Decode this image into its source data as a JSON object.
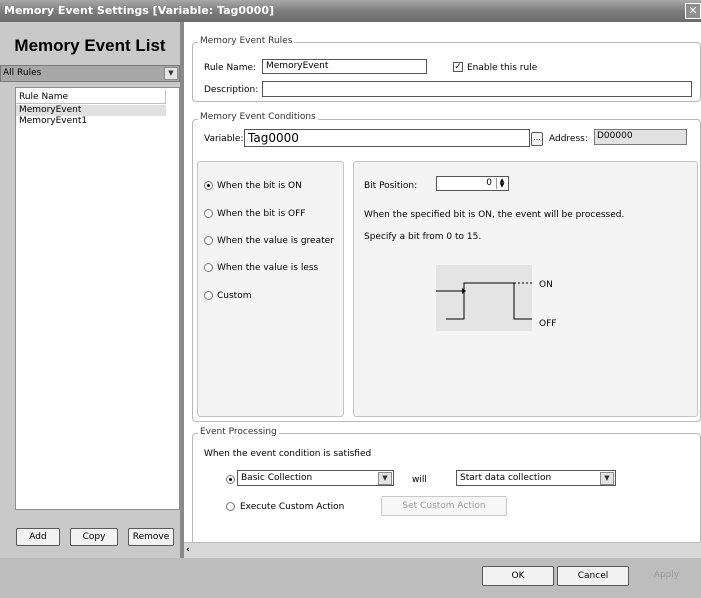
{
  "window": {
    "title": "Memory Event Settings [Variable: Tag0000]",
    "close_glyph": "✕"
  },
  "left": {
    "heading": "Memory Event List",
    "filter_value": "All Rules",
    "column_header": "Rule Name",
    "rules": [
      "MemoryEvent",
      "MemoryEvent1"
    ],
    "buttons": {
      "add": "Add",
      "copy": "Copy",
      "remove": "Remove"
    }
  },
  "rules_group": {
    "label": "Memory Event Rules",
    "rule_name_label": "Rule Name:",
    "rule_name_value": "MemoryEvent",
    "enable_label": "Enable this rule",
    "enable_checked": true,
    "description_label": "Description:",
    "description_value": ""
  },
  "conditions_group": {
    "label": "Memory Event Conditions",
    "variable_label": "Variable:",
    "variable_value": "Tag0000",
    "browse_label": "...",
    "address_label": "Address:",
    "address_value": "D00000",
    "options": [
      "When the bit is ON",
      "When the bit is OFF",
      "When the value is greater",
      "When the value is less",
      "Custom"
    ],
    "selected_index": 0,
    "bit_position_label": "Bit Position:",
    "bit_position_value": "0",
    "info_text": "When the specified bit is ON, the event will be processed.",
    "range_text": "Specify a bit from 0 to 15.",
    "diagram_on_label": "ON",
    "diagram_off_label": "OFF"
  },
  "processing_group": {
    "label": "Event Processing",
    "condition_text": "When the event condition is satisfied",
    "collection_value": "Basic Collection",
    "will_label": "will",
    "action_value": "Start data collection",
    "custom_action_label": "Execute Custom Action",
    "set_custom_action_label": "Set Custom Action"
  },
  "footer": {
    "ok": "OK",
    "cancel": "Cancel",
    "apply": "Apply"
  },
  "colors": {
    "titlebar": "#7d7d7d",
    "left_bg": "#c9c9c9",
    "panel_bg": "#ffffff",
    "disabled_text": "#9a9a9a"
  }
}
